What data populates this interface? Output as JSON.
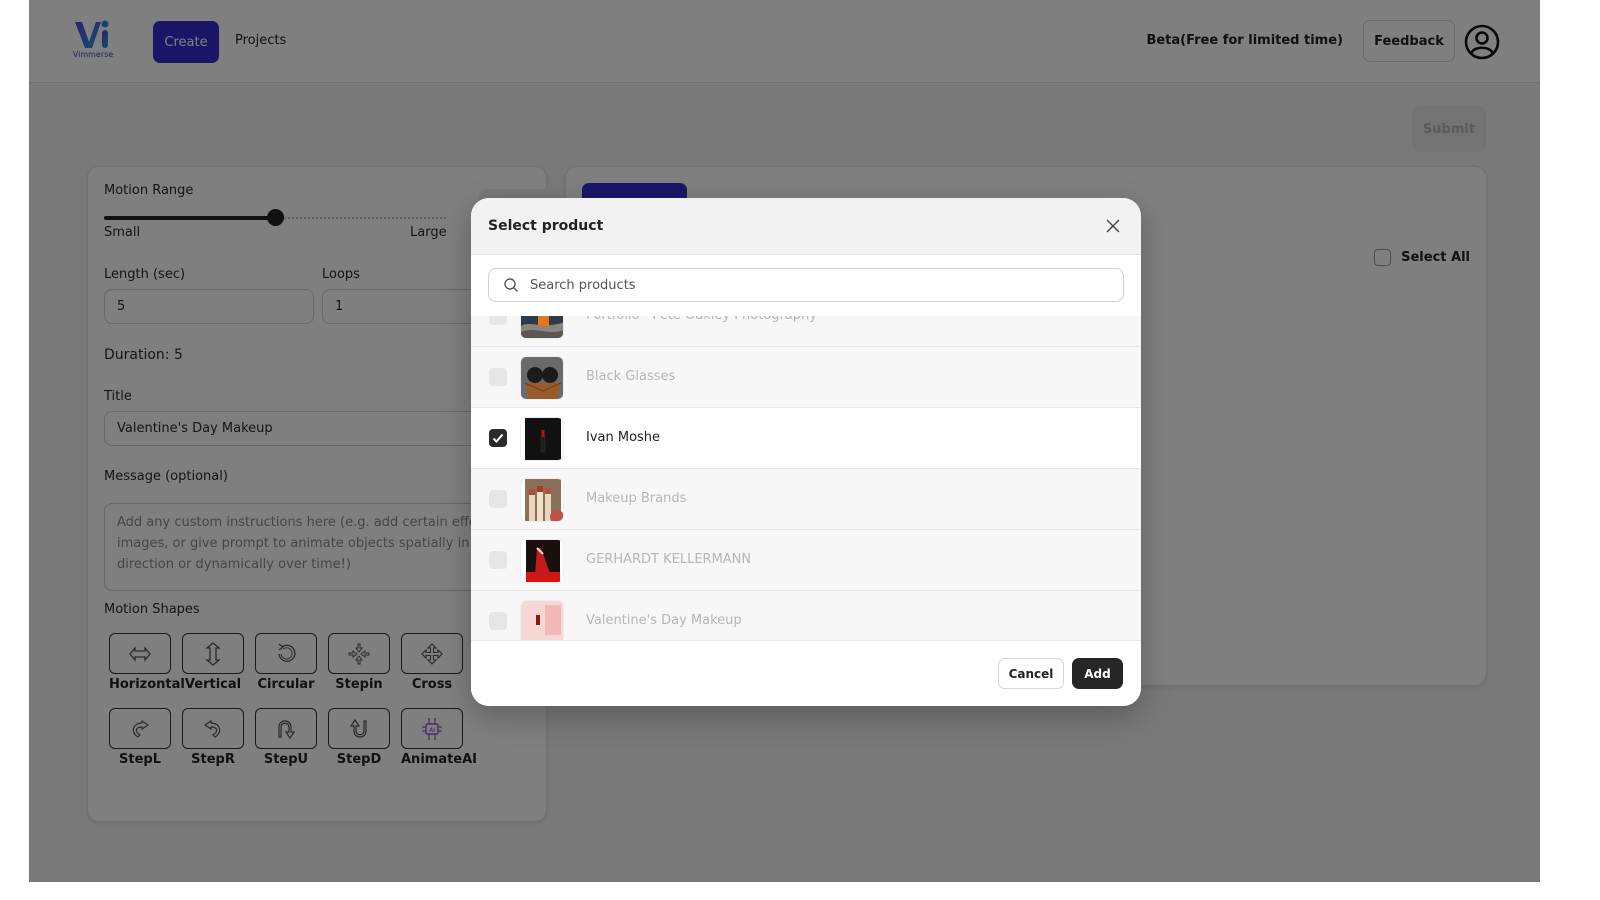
{
  "header": {
    "logo_text": "Vimmerse",
    "nav": [
      {
        "label": "Create",
        "active": true
      },
      {
        "label": "Projects",
        "active": false
      }
    ],
    "beta_label": "Beta(Free for limited time)",
    "feedback_label": "Feedback",
    "avatar_icon": "user-circle-icon"
  },
  "toolbar": {
    "submit_label": "Submit",
    "submit_disabled": true
  },
  "settings": {
    "motion_range": {
      "label": "Motion Range",
      "min_label": "Small",
      "max_label": "Large",
      "value_fraction": 0.5
    },
    "length": {
      "label": "Length (sec)",
      "value": "5"
    },
    "loops": {
      "label": "Loops",
      "value": "1"
    },
    "duration_text": "Duration: 5",
    "title": {
      "label": "Title",
      "value": "Valentine's Day Makeup"
    },
    "message": {
      "label": "Message (optional)",
      "placeholder": "Add any custom instructions here (e.g. add certain effects to images, or give prompt to animate objects spatially in a given direction or dynamically over time!)"
    },
    "motion_shapes": {
      "label": "Motion Shapes",
      "items": [
        {
          "label": "Horizontal",
          "icon": "horizontal-arrows-icon"
        },
        {
          "label": "Vertical",
          "icon": "vertical-arrows-icon"
        },
        {
          "label": "Circular",
          "icon": "circular-arrow-icon"
        },
        {
          "label": "Stepin",
          "icon": "step-in-icon"
        },
        {
          "label": "Cross",
          "icon": "cross-arrows-icon"
        },
        {
          "label": "StepL",
          "icon": "step-left-icon"
        },
        {
          "label": "StepR",
          "icon": "step-right-icon"
        },
        {
          "label": "StepU",
          "icon": "step-up-icon"
        },
        {
          "label": "StepD",
          "icon": "step-down-icon"
        },
        {
          "label": "AnimateAI",
          "icon": "ai-chip-icon"
        }
      ]
    }
  },
  "media_panel": {
    "select_all_label": "Select All",
    "select_all_checked": false
  },
  "modal": {
    "title": "Select product",
    "search_placeholder": "Search products",
    "products": [
      {
        "name": "Portfolio - Pete Oakley Photography",
        "checked": false,
        "thumb": "perfume-bottle"
      },
      {
        "name": "Black Glasses",
        "checked": false,
        "thumb": "sunglasses-case"
      },
      {
        "name": "Ivan Moshe",
        "checked": true,
        "thumb": "lipstick-dark"
      },
      {
        "name": "Makeup Brands",
        "checked": false,
        "thumb": "lipsticks"
      },
      {
        "name": "GERHARDT KELLERMANN",
        "checked": false,
        "thumb": "red-glasses"
      },
      {
        "name": "Valentine's Day Makeup",
        "checked": false,
        "thumb": "pink-lipstick"
      }
    ],
    "cancel_label": "Cancel",
    "add_label": "Add"
  },
  "colors": {
    "brand": "#3a2bd0",
    "selected_checkbox": "#2b2b2b",
    "primary_dark": "#262626"
  }
}
